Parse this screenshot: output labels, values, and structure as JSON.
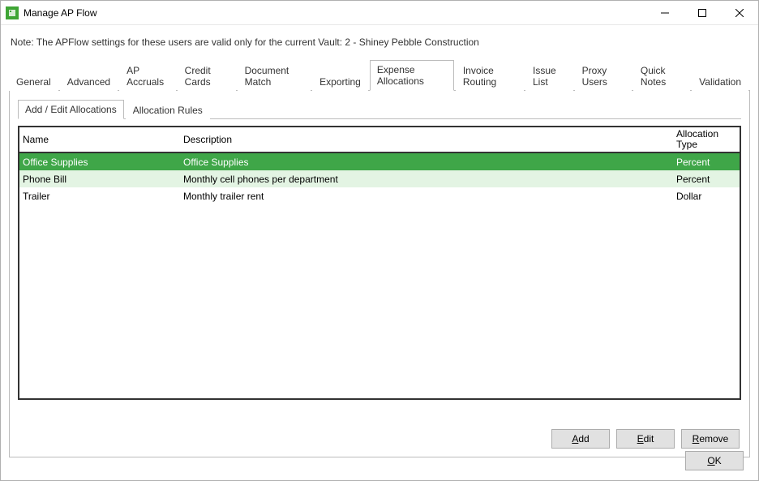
{
  "window": {
    "title": "Manage AP Flow",
    "icon_name": "app-icon"
  },
  "note": "Note:  The APFlow settings for these users are valid only for the current Vault: 2 - Shiney Pebble Construction",
  "main_tabs": [
    {
      "label": "General",
      "active": false
    },
    {
      "label": "Advanced",
      "active": false
    },
    {
      "label": "AP Accruals",
      "active": false
    },
    {
      "label": "Credit Cards",
      "active": false
    },
    {
      "label": "Document Match",
      "active": false
    },
    {
      "label": "Exporting",
      "active": false
    },
    {
      "label": "Expense Allocations",
      "active": true
    },
    {
      "label": "Invoice Routing",
      "active": false
    },
    {
      "label": "Issue List",
      "active": false
    },
    {
      "label": "Proxy Users",
      "active": false
    },
    {
      "label": "Quick Notes",
      "active": false
    },
    {
      "label": "Validation",
      "active": false
    }
  ],
  "sub_tabs": [
    {
      "label": "Add / Edit Allocations",
      "active": true
    },
    {
      "label": "Allocation Rules",
      "active": false
    }
  ],
  "table": {
    "headers": {
      "name": "Name",
      "description": "Description",
      "type_l1": "Allocation",
      "type_l2": "Type"
    },
    "rows": [
      {
        "name": "Office Supplies",
        "description": "Office Supplies",
        "type": "Percent",
        "state": "selected"
      },
      {
        "name": "Phone Bill",
        "description": "Monthly cell phones per department",
        "type": "Percent",
        "state": "alt"
      },
      {
        "name": "Trailer",
        "description": "Monthly trailer rent",
        "type": "Dollar",
        "state": "normal"
      }
    ]
  },
  "buttons": {
    "add": "Add",
    "edit": "Edit",
    "remove": "Remove",
    "ok": "OK"
  }
}
